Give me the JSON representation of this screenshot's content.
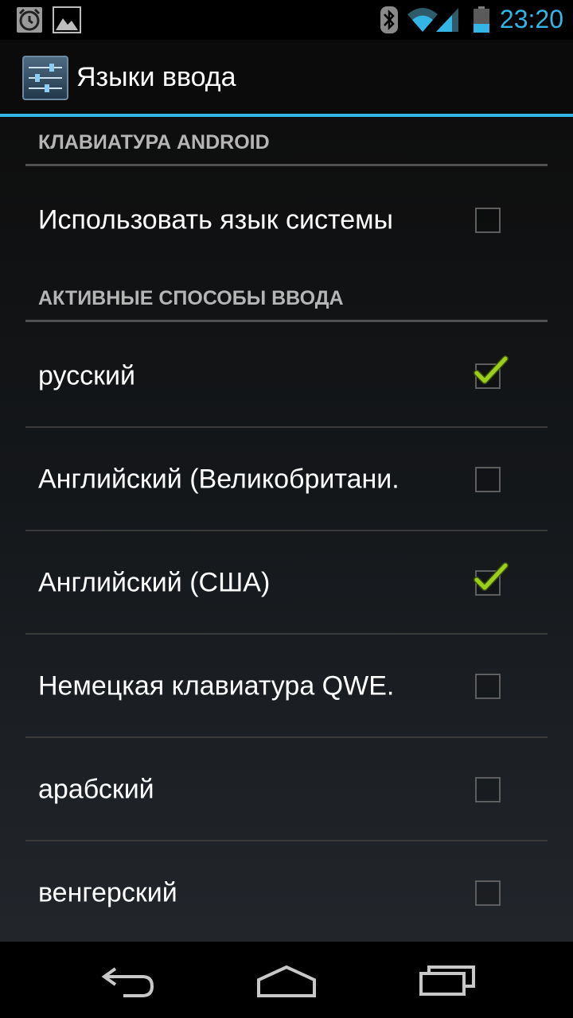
{
  "status_bar": {
    "time": "23:20",
    "icons": [
      "alarm-icon",
      "gallery-icon",
      "bluetooth-icon",
      "wifi-icon",
      "signal-icon",
      "battery-icon"
    ],
    "accent_color": "#33b5e5"
  },
  "action_bar": {
    "title": "Языки ввода",
    "icon": "settings-sliders-icon"
  },
  "sections": [
    {
      "header": "КЛАВИАТУРА ANDROID",
      "items": [
        {
          "label": "Использовать язык системы",
          "checked": false
        }
      ]
    },
    {
      "header": "АКТИВНЫЕ СПОСОБЫ ВВОДА",
      "items": [
        {
          "label": "русский",
          "checked": true
        },
        {
          "label": "Английский (Великобритани.",
          "checked": false
        },
        {
          "label": "Английский (США)",
          "checked": true
        },
        {
          "label": "Немецкая клавиатура QWE.",
          "checked": false
        },
        {
          "label": "арабский",
          "checked": false
        },
        {
          "label": "венгерский",
          "checked": false
        }
      ]
    }
  ],
  "nav_bar": {
    "icons": [
      "back-icon",
      "home-icon",
      "recent-apps-icon"
    ]
  },
  "colors": {
    "check_mark": "#9ccf1a",
    "section_header": "#b5b5b5"
  }
}
